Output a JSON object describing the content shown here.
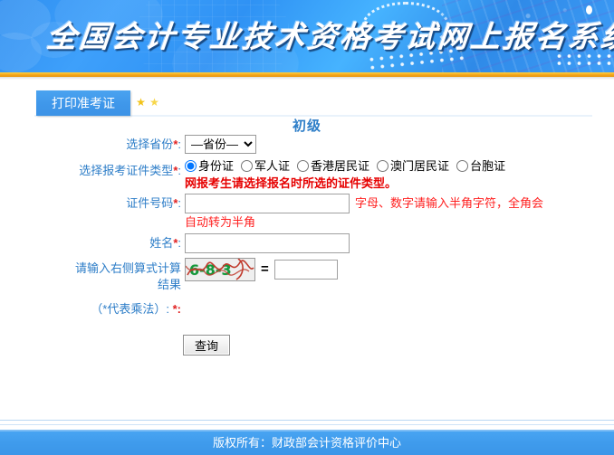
{
  "banner": {
    "title": "全国会计专业技术资格考试网上报名系统"
  },
  "tabs": {
    "print_admission_ticket": "打印准考证",
    "star_icon_1": "star-icon",
    "star_icon_2": "star-icon"
  },
  "page": {
    "level_title": "初级"
  },
  "form": {
    "province": {
      "label": "选择省份",
      "required_mark": "*",
      "colon": ":",
      "selected": "—省份—",
      "options": [
        "—省份—"
      ]
    },
    "id_type": {
      "label": "选择报考证件类型",
      "required_mark": "*",
      "colon": ":",
      "options": [
        "身份证",
        "军人证",
        "香港居民证",
        "澳门居民证",
        "台胞证"
      ],
      "selected": "身份证",
      "warning": "网报考生请选择报名时所选的证件类型。"
    },
    "id_number": {
      "label": "证件号码",
      "required_mark": "*",
      "colon": ":",
      "value": "",
      "placeholder": "",
      "hint_line1": "字母、数字请输入半角字符，全角会",
      "hint_line2": "自动转为半角"
    },
    "name": {
      "label": "姓名",
      "required_mark": "*",
      "colon": ":",
      "value": "",
      "placeholder": ""
    },
    "captcha": {
      "label_line1": "请输入右侧算式计算",
      "label_line2": "结果",
      "image_text": "6-8-3",
      "equals": "=",
      "value": "",
      "placeholder": ""
    },
    "note": {
      "text": "（*代表乘法）:",
      "required_mark": "*",
      "colon": ":"
    },
    "submit": {
      "label": "查询"
    }
  },
  "footer": {
    "copyright": "版权所有：财政部会计资格评价中心"
  },
  "colors": {
    "banner_blue": "#3f9ef7",
    "gold_bar": "#f6a91c",
    "label_blue": "#2e7ec8",
    "required_red": "#e02020",
    "warning_red": "#e60000",
    "hint_red": "#ff2020",
    "tab_blue": "#3f97ea",
    "footer_blue": "#3f9bec",
    "captcha_green": "#149a3c",
    "captcha_scribble": "#c0392b"
  }
}
